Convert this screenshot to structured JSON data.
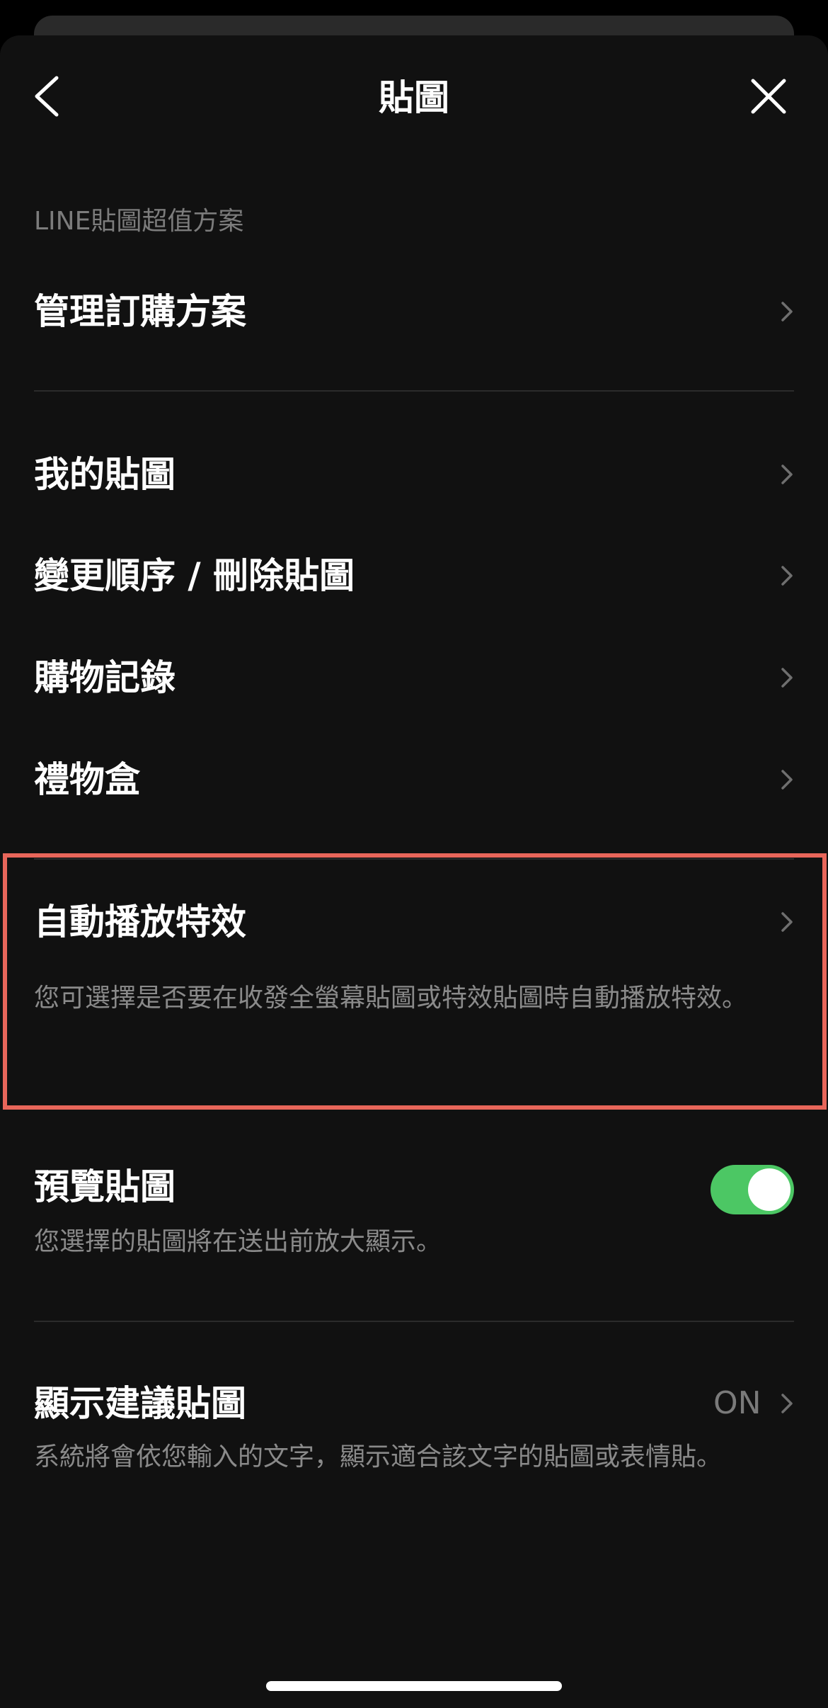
{
  "header": {
    "title": "貼圖",
    "back_icon": "chevron-left-icon",
    "close_icon": "close-icon"
  },
  "section_label": "LINE貼圖超值方案",
  "items": [
    {
      "label": "管理訂購方案"
    },
    {
      "label": "我的貼圖"
    },
    {
      "label": "變更順序 / 刪除貼圖"
    },
    {
      "label": "購物記錄"
    },
    {
      "label": "禮物盒"
    },
    {
      "label": "自動播放特效",
      "description": "您可選擇是否要在收發全螢幕貼圖或特效貼圖時自動播放特效。"
    },
    {
      "label": "預覽貼圖",
      "description": "您選擇的貼圖將在送出前放大顯示。",
      "toggle_on": true
    },
    {
      "label": "顯示建議貼圖",
      "value": "ON",
      "description": "系統將會依您輸入的文字，顯示適合該文字的貼圖或表情貼。"
    }
  ],
  "colors": {
    "background": "#111111",
    "toggle_on": "#4cc764",
    "highlight_border": "#e8665a"
  }
}
